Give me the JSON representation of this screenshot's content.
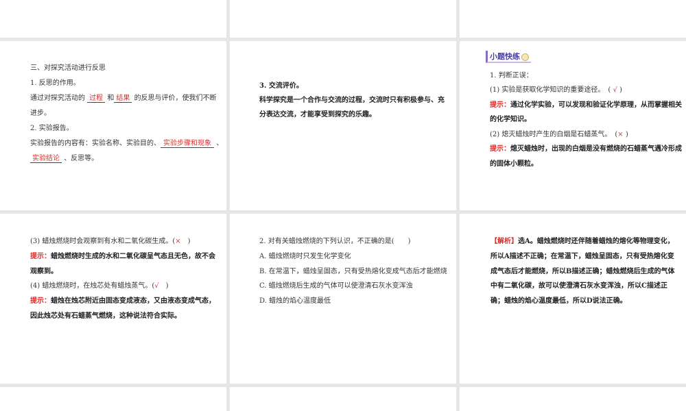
{
  "s1": {
    "heading": "三、对探究活动进行反思",
    "p1": "1. 反思的作用。",
    "l3a": "通过对探究活动的",
    "b1": "过程",
    "and": "和",
    "b2": "结果",
    "l3b": "的反思与评价，使我们不断",
    "l4": "进步。",
    "p2": "2. 实验报告。",
    "l6a": "实验报告的内容有：实验名称、实验目的、",
    "b3": "实验步骤和现象",
    "comma": "、",
    "b4": "实验结论",
    "l7b": "、反思等。"
  },
  "s2": {
    "l1": "3. 交流评价。",
    "l2": "科学探究是一个合作与交流的过程，交流时只有积极参与、充",
    "l3": "分表达交流，才能享受到探究的乐趣。"
  },
  "s3": {
    "badge": "小题快练",
    "q": "1. 判断正误：",
    "i1": "(1) 实验是获取化学知识的重要途径。　(",
    "a1": "√",
    "close": ")",
    "hint": "提示：",
    "h1a": "通过化学实验，可以发现和验证化学原理，从而掌握相关",
    "h1b": "的化学知识。",
    "i2": "(2) 熄灭蜡烛时产生的白烟是石蜡蒸气。　(",
    "a2": "×",
    "h2a": "熄灭蜡烛时，出现的白烟是没有燃烧的石蜡蒸气遇冷形成",
    "h2b": "的固体小颗粒。"
  },
  "s4": {
    "i3": "(3) 蜡烛燃烧时会观察到有水和二氧化碳生成。(",
    "a3": "×",
    "close": ")",
    "hint": "提示：",
    "h3a": "蜡烛燃烧时生成的水和二氧化碳呈气态且无色，故不会",
    "h3b": "观察到。",
    "i4": "(4) 蜡烛燃烧时，在烛芯处有蜡烛蒸气。(",
    "a4": "√",
    "h4a": "蜡烛在烛芯附近由固态变成液态，又由液态变成气态，",
    "h4b": "因此烛芯处有石蜡蒸气燃烧，这种说法符合实际。"
  },
  "s5": {
    "q": "2. 对有关蜡烛燃烧的下列认识，不正确的是(　　)",
    "options": [
      "A. 蜡烛燃烧时只发生化学变化",
      "B. 在常温下，蜡烛呈固态，只有受热熔化变成气态后才能燃烧",
      "C. 蜡烛燃烧后生成的气体可以使澄清石灰水变浑浊",
      "D. 蜡烛的焰心温度最低"
    ]
  },
  "s6": {
    "tag": "【解析】",
    "l1": "选A。蜡烛燃烧时还伴随着蜡烛的熔化等物理变化，",
    "l2": "所以A描述不正确；在常温下，蜡烛呈固态，只有受热熔化变",
    "l3": "成气态后才能燃烧，所以B描述正确；蜡烛燃烧后生成的气体",
    "l4": "中有二氧化碳，故可以使澄清石灰水变浑浊，所以C描述正",
    "l5": "确；蜡烛的焰心温度最低，所以D说法正确。"
  }
}
